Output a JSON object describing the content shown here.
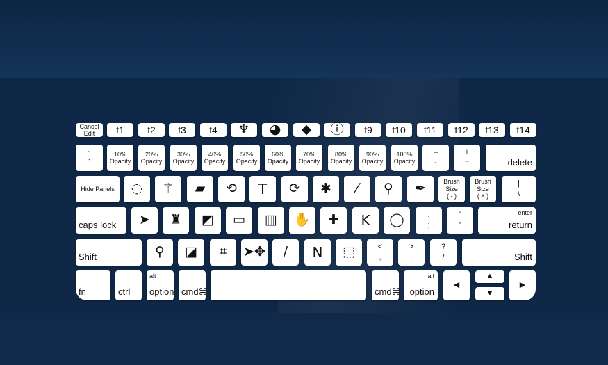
{
  "background": {
    "top": "#0f2847",
    "middle": "#2a5a88",
    "bottom": "#11294a",
    "key": "#ffffff"
  },
  "rows": [
    [
      {
        "label": "Cancel\nEdit",
        "style": "small"
      },
      {
        "label": "f1",
        "style": "fn"
      },
      {
        "label": "f2",
        "style": "fn"
      },
      {
        "label": "f3",
        "style": "fn"
      },
      {
        "label": "f4",
        "style": "fn"
      },
      {
        "icon": "puppet-warp-icon",
        "label": "♆",
        "style": "icon"
      },
      {
        "icon": "palette-icon",
        "label": "◕",
        "style": "icon"
      },
      {
        "icon": "layers-icon",
        "label": "◆",
        "style": "icon"
      },
      {
        "icon": "info-icon",
        "label": "ⓘ",
        "style": "icon"
      },
      {
        "label": "f9",
        "style": "fn"
      },
      {
        "label": "f10",
        "style": "fn"
      },
      {
        "label": "f11",
        "style": "fn"
      },
      {
        "label": "f12",
        "style": "fn"
      },
      {
        "label": "f13",
        "style": "fn"
      },
      {
        "label": "f14",
        "style": "fn"
      }
    ],
    [
      {
        "label": "~\n`",
        "style": "sym"
      },
      {
        "label": "10%\nOpacity",
        "style": "small"
      },
      {
        "label": "20%\nOpacity",
        "style": "small"
      },
      {
        "label": "30%\nOpacity",
        "style": "small"
      },
      {
        "label": "40%\nOpacity",
        "style": "small"
      },
      {
        "label": "50%\nOpacity",
        "style": "small"
      },
      {
        "label": "60%\nOpacity",
        "style": "small"
      },
      {
        "label": "70%\nOpacity",
        "style": "small"
      },
      {
        "label": "80%\nOpacity",
        "style": "small"
      },
      {
        "label": "90%\nOpacity",
        "style": "small"
      },
      {
        "label": "100%\nOpacity",
        "style": "small"
      },
      {
        "label": "–\n-",
        "style": "sym"
      },
      {
        "label": "+\n=",
        "style": "sym"
      },
      {
        "label": "delete",
        "style": "br"
      }
    ],
    [
      {
        "label": "Hide Panels",
        "style": "small"
      },
      {
        "icon": "elliptical-marquee-icon",
        "label": "◌",
        "style": "icon"
      },
      {
        "icon": "magic-wand-icon",
        "label": "⚚",
        "style": "icon"
      },
      {
        "icon": "eraser-icon",
        "label": "▰",
        "style": "icon"
      },
      {
        "icon": "history-brush-icon",
        "label": "⟲",
        "style": "icon"
      },
      {
        "icon": "type-tool-icon",
        "label": "T",
        "style": "txt"
      },
      {
        "icon": "art-history-icon",
        "label": "⟳",
        "style": "icon"
      },
      {
        "icon": "puppet-icon",
        "label": "✱",
        "style": "icon"
      },
      {
        "icon": "eyedropper-icon",
        "label": "⁄",
        "style": "icon"
      },
      {
        "icon": "zoom-icon",
        "label": "⚲",
        "style": "icon"
      },
      {
        "icon": "pen-tool-icon",
        "label": "✒",
        "style": "icon"
      },
      {
        "label": "Brush\nSize\n( - )",
        "style": "small"
      },
      {
        "label": "Brush\nSize\n( + )",
        "style": "small"
      },
      {
        "label": "|\n\\",
        "style": "sym"
      }
    ],
    [
      {
        "label": "caps lock",
        "style": "bl"
      },
      {
        "icon": "move-arrow-icon",
        "label": "➤",
        "style": "icon"
      },
      {
        "icon": "stamp-icon",
        "label": "♜",
        "style": "icon"
      },
      {
        "icon": "default-colors-icon",
        "label": "◩",
        "style": "icon"
      },
      {
        "icon": "screen-mode-icon",
        "label": "▭",
        "style": "icon"
      },
      {
        "icon": "gradient-icon",
        "label": "▥",
        "style": "icon"
      },
      {
        "icon": "hand-icon",
        "label": "✋",
        "style": "icon"
      },
      {
        "icon": "healing-brush-icon",
        "label": "✚",
        "style": "icon"
      },
      {
        "label": "K",
        "style": "txt"
      },
      {
        "icon": "lasso-icon",
        "label": "◯",
        "style": "icon"
      },
      {
        "label": ":\n;",
        "style": "sym"
      },
      {
        "label": "\"\n'",
        "style": "sym"
      },
      {
        "label": "return",
        "sub": "enter",
        "style": "br"
      }
    ],
    [
      {
        "label": "Shift",
        "style": "bl"
      },
      {
        "icon": "magnifier-icon",
        "label": "⚲",
        "style": "icon"
      },
      {
        "icon": "swap-colors-icon",
        "label": "◪",
        "style": "icon"
      },
      {
        "icon": "crop-icon",
        "label": "⌗",
        "style": "icon"
      },
      {
        "icon": "path-selection-icon",
        "label": "➤✥",
        "style": "icon"
      },
      {
        "icon": "brush-icon",
        "label": "∕",
        "style": "icon"
      },
      {
        "label": "N",
        "style": "txt"
      },
      {
        "icon": "rectangular-marquee-icon",
        "label": "⬚",
        "style": "icon"
      },
      {
        "label": "<\n,",
        "style": "sym"
      },
      {
        "label": ">\n.",
        "style": "sym"
      },
      {
        "label": "?\n/",
        "style": "sym"
      },
      {
        "label": "Shift",
        "style": "br"
      }
    ],
    [
      {
        "label": "fn",
        "style": "bl"
      },
      {
        "label": "ctrl",
        "style": "bl"
      },
      {
        "label": "option",
        "sub": "alt",
        "style": "bl"
      },
      {
        "label": "cmd⌘",
        "style": "bl"
      },
      {
        "label": "",
        "style": "space"
      },
      {
        "label": "cmd⌘",
        "style": "bl"
      },
      {
        "label": "option",
        "sub": "alt",
        "style": "br"
      },
      {
        "icon": "arrow-left-icon",
        "label": "◀",
        "style": "arrow"
      },
      {
        "icon": "arrow-up-icon",
        "label": "▲",
        "style": "arrow"
      },
      {
        "icon": "arrow-down-icon",
        "label": "▼",
        "style": "arrow"
      },
      {
        "icon": "arrow-right-icon",
        "label": "▶",
        "style": "arrow"
      }
    ]
  ]
}
